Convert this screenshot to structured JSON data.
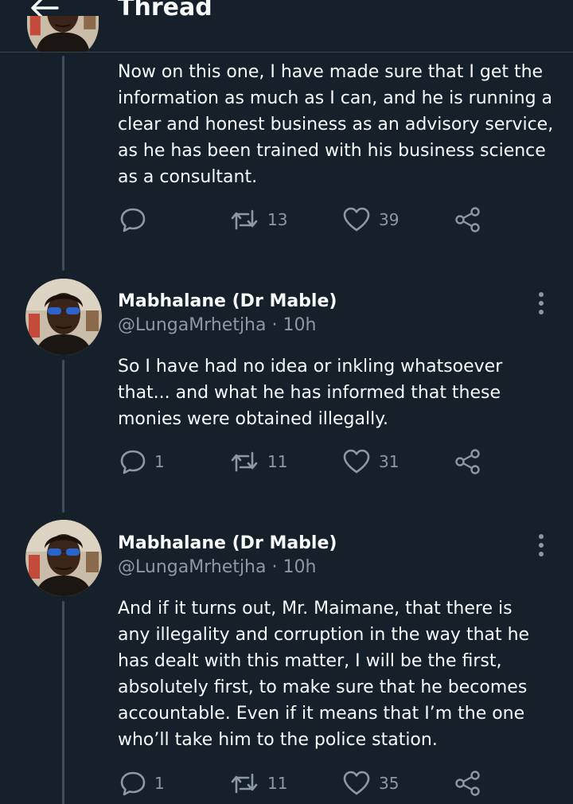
{
  "header": {
    "title": "Thread",
    "back_icon": "arrow-left-icon"
  },
  "tweets": [
    {
      "text": "Now on this one, I have made sure that I get the information as much as I can, and he is running a clear and honest business as an advisory service, as he has been trained with his business science as a consultant.",
      "replies": "",
      "retweets": "13",
      "likes": "39"
    },
    {
      "name": "Mabhalane (Dr Mable)",
      "handle": "@LungaMrhetjha",
      "separator": "·",
      "time": "10h",
      "text": "So I have had no idea or inkling whatsoever that... and what he has informed that these monies were obtained illegally.",
      "replies": "1",
      "retweets": "11",
      "likes": "31"
    },
    {
      "name": "Mabhalane (Dr Mable)",
      "handle": "@LungaMrhetjha",
      "separator": "·",
      "time": "10h",
      "text": "And if it turns out, Mr. Maimane, that there is any illegality and corruption in the way that he has dealt with this matter, I will be the first, absolutely first, to make sure that he becomes accountable. Even if it means that I’m the one who’ll take him to the police station.",
      "replies": "1",
      "retweets": "11",
      "likes": "35"
    }
  ],
  "colors": {
    "background": "#15202b",
    "text": "#f7f9f9",
    "muted": "#8b98a5",
    "divider": "#38444d",
    "thread_line": "#3d4d5c"
  }
}
